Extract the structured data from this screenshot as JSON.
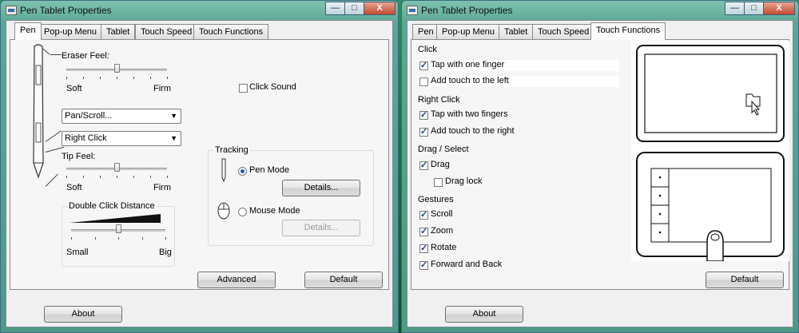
{
  "window_title": "Pen Tablet Properties",
  "caption_buttons": {
    "minimize": "—",
    "maximize": "□",
    "close": "X"
  },
  "tabs": [
    "Pen",
    "Pop-up Menu",
    "Tablet",
    "Touch Speed",
    "Touch Functions"
  ],
  "about_label": "About",
  "left": {
    "active_tab": "Pen",
    "eraser_feel": {
      "label": "Eraser Feel:",
      "min_label": "Soft",
      "max_label": "Firm",
      "value_fraction": 0.5
    },
    "click_sound": {
      "label": "Click Sound",
      "checked": false
    },
    "upper_button": {
      "value": "Pan/Scroll..."
    },
    "lower_button": {
      "value": "Right Click"
    },
    "tip_feel": {
      "label": "Tip Feel:",
      "min_label": "Soft",
      "max_label": "Firm",
      "value_fraction": 0.5
    },
    "double_click": {
      "label": "Double Click Distance",
      "min_label": "Small",
      "max_label": "Big",
      "value_fraction": 0.5
    },
    "tracking": {
      "label": "Tracking",
      "pen_mode": {
        "label": "Pen Mode",
        "selected": true,
        "details_label": "Details..."
      },
      "mouse_mode": {
        "label": "Mouse Mode",
        "selected": false,
        "details_label": "Details..."
      }
    },
    "advanced_label": "Advanced",
    "default_label": "Default"
  },
  "right": {
    "active_tab": "Touch Functions",
    "sections": [
      {
        "heading": "Click",
        "items": [
          {
            "label": "Tap with one finger",
            "checked": true
          },
          {
            "label": "Add touch to the left",
            "checked": false
          }
        ]
      },
      {
        "heading": "Right Click",
        "items": [
          {
            "label": "Tap with two fingers",
            "checked": true
          },
          {
            "label": "Add touch to the right",
            "checked": true
          }
        ]
      },
      {
        "heading": "Drag / Select",
        "items": [
          {
            "label": "Drag",
            "checked": true
          },
          {
            "label": "Drag lock",
            "checked": false
          }
        ]
      },
      {
        "heading": "Gestures",
        "items": [
          {
            "label": "Scroll",
            "checked": true
          },
          {
            "label": "Zoom",
            "checked": true
          },
          {
            "label": "Rotate",
            "checked": true
          },
          {
            "label": "Forward and Back",
            "checked": true
          }
        ]
      }
    ],
    "default_label": "Default"
  }
}
